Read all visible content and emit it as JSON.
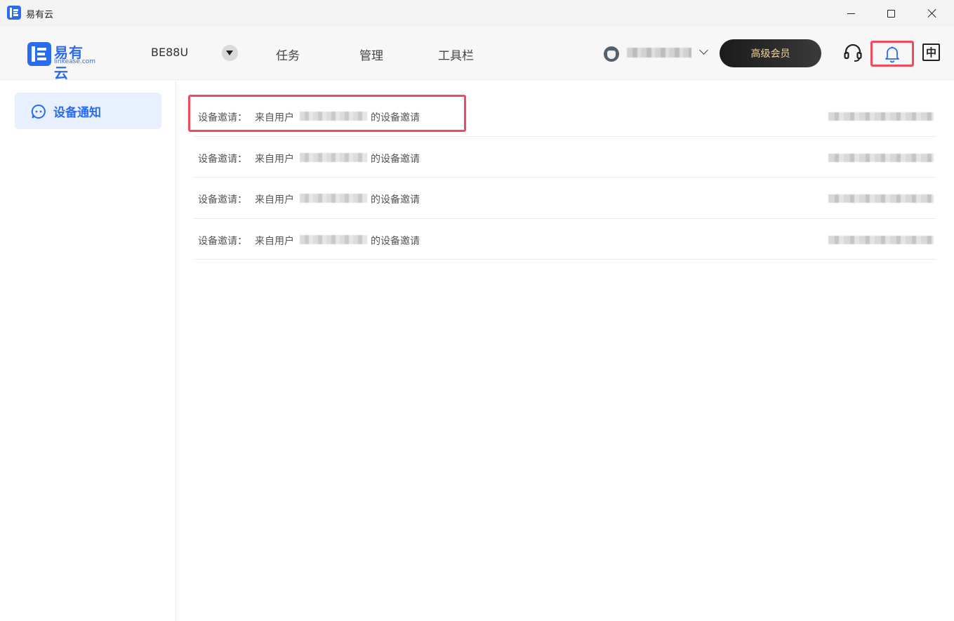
{
  "window": {
    "title": "易有云"
  },
  "header": {
    "logo_name": "易有云",
    "logo_sub": "linkease.com",
    "device_name": "BE88U",
    "nav": [
      "任务",
      "管理",
      "工具栏"
    ],
    "username": "redacted-username",
    "vip_label": "高级会员",
    "lang_label": "中"
  },
  "sidebar": {
    "items": [
      {
        "label": "设备通知"
      }
    ]
  },
  "notifications": [
    {
      "prefix": "设备邀请：",
      "text": "来自用户",
      "user": "1xxxxxxxxx0",
      "suffix": "的设备邀请",
      "time": "redacted"
    },
    {
      "prefix": "设备邀请：",
      "text": "来自用户",
      "user": "xxxxxxxxxx",
      "suffix": "的设备邀请",
      "time": "redacted"
    },
    {
      "prefix": "设备邀请：",
      "text": "来自用户",
      "user": "1xxxxxxxxx0",
      "suffix": "的设备邀请",
      "time": "redacted"
    },
    {
      "prefix": "设备邀请：",
      "text": "来自用户",
      "user": "xxxxxxxxxx",
      "suffix": "的设备邀请",
      "time": "redacted"
    }
  ],
  "colors": {
    "brand": "#2a6cf0",
    "highlight": "#f14c5e",
    "vip_text": "#f0d6a8"
  }
}
